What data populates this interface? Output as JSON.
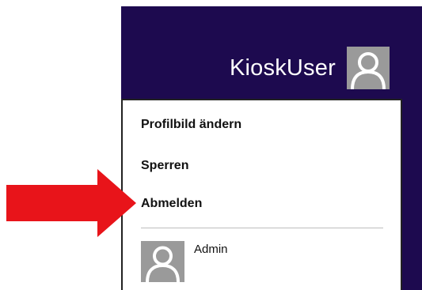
{
  "account": {
    "current_user": "KioskUser",
    "menu_items": [
      "Profilbild ändern",
      "Sperren",
      "Abmelden"
    ],
    "other_user": "Admin"
  },
  "annotation": {
    "arrow_color": "#e8141a",
    "arrow_target": "Abmelden"
  },
  "colors": {
    "start_background": "#1d0a4f",
    "avatar_gray": "#9a9a9a"
  }
}
